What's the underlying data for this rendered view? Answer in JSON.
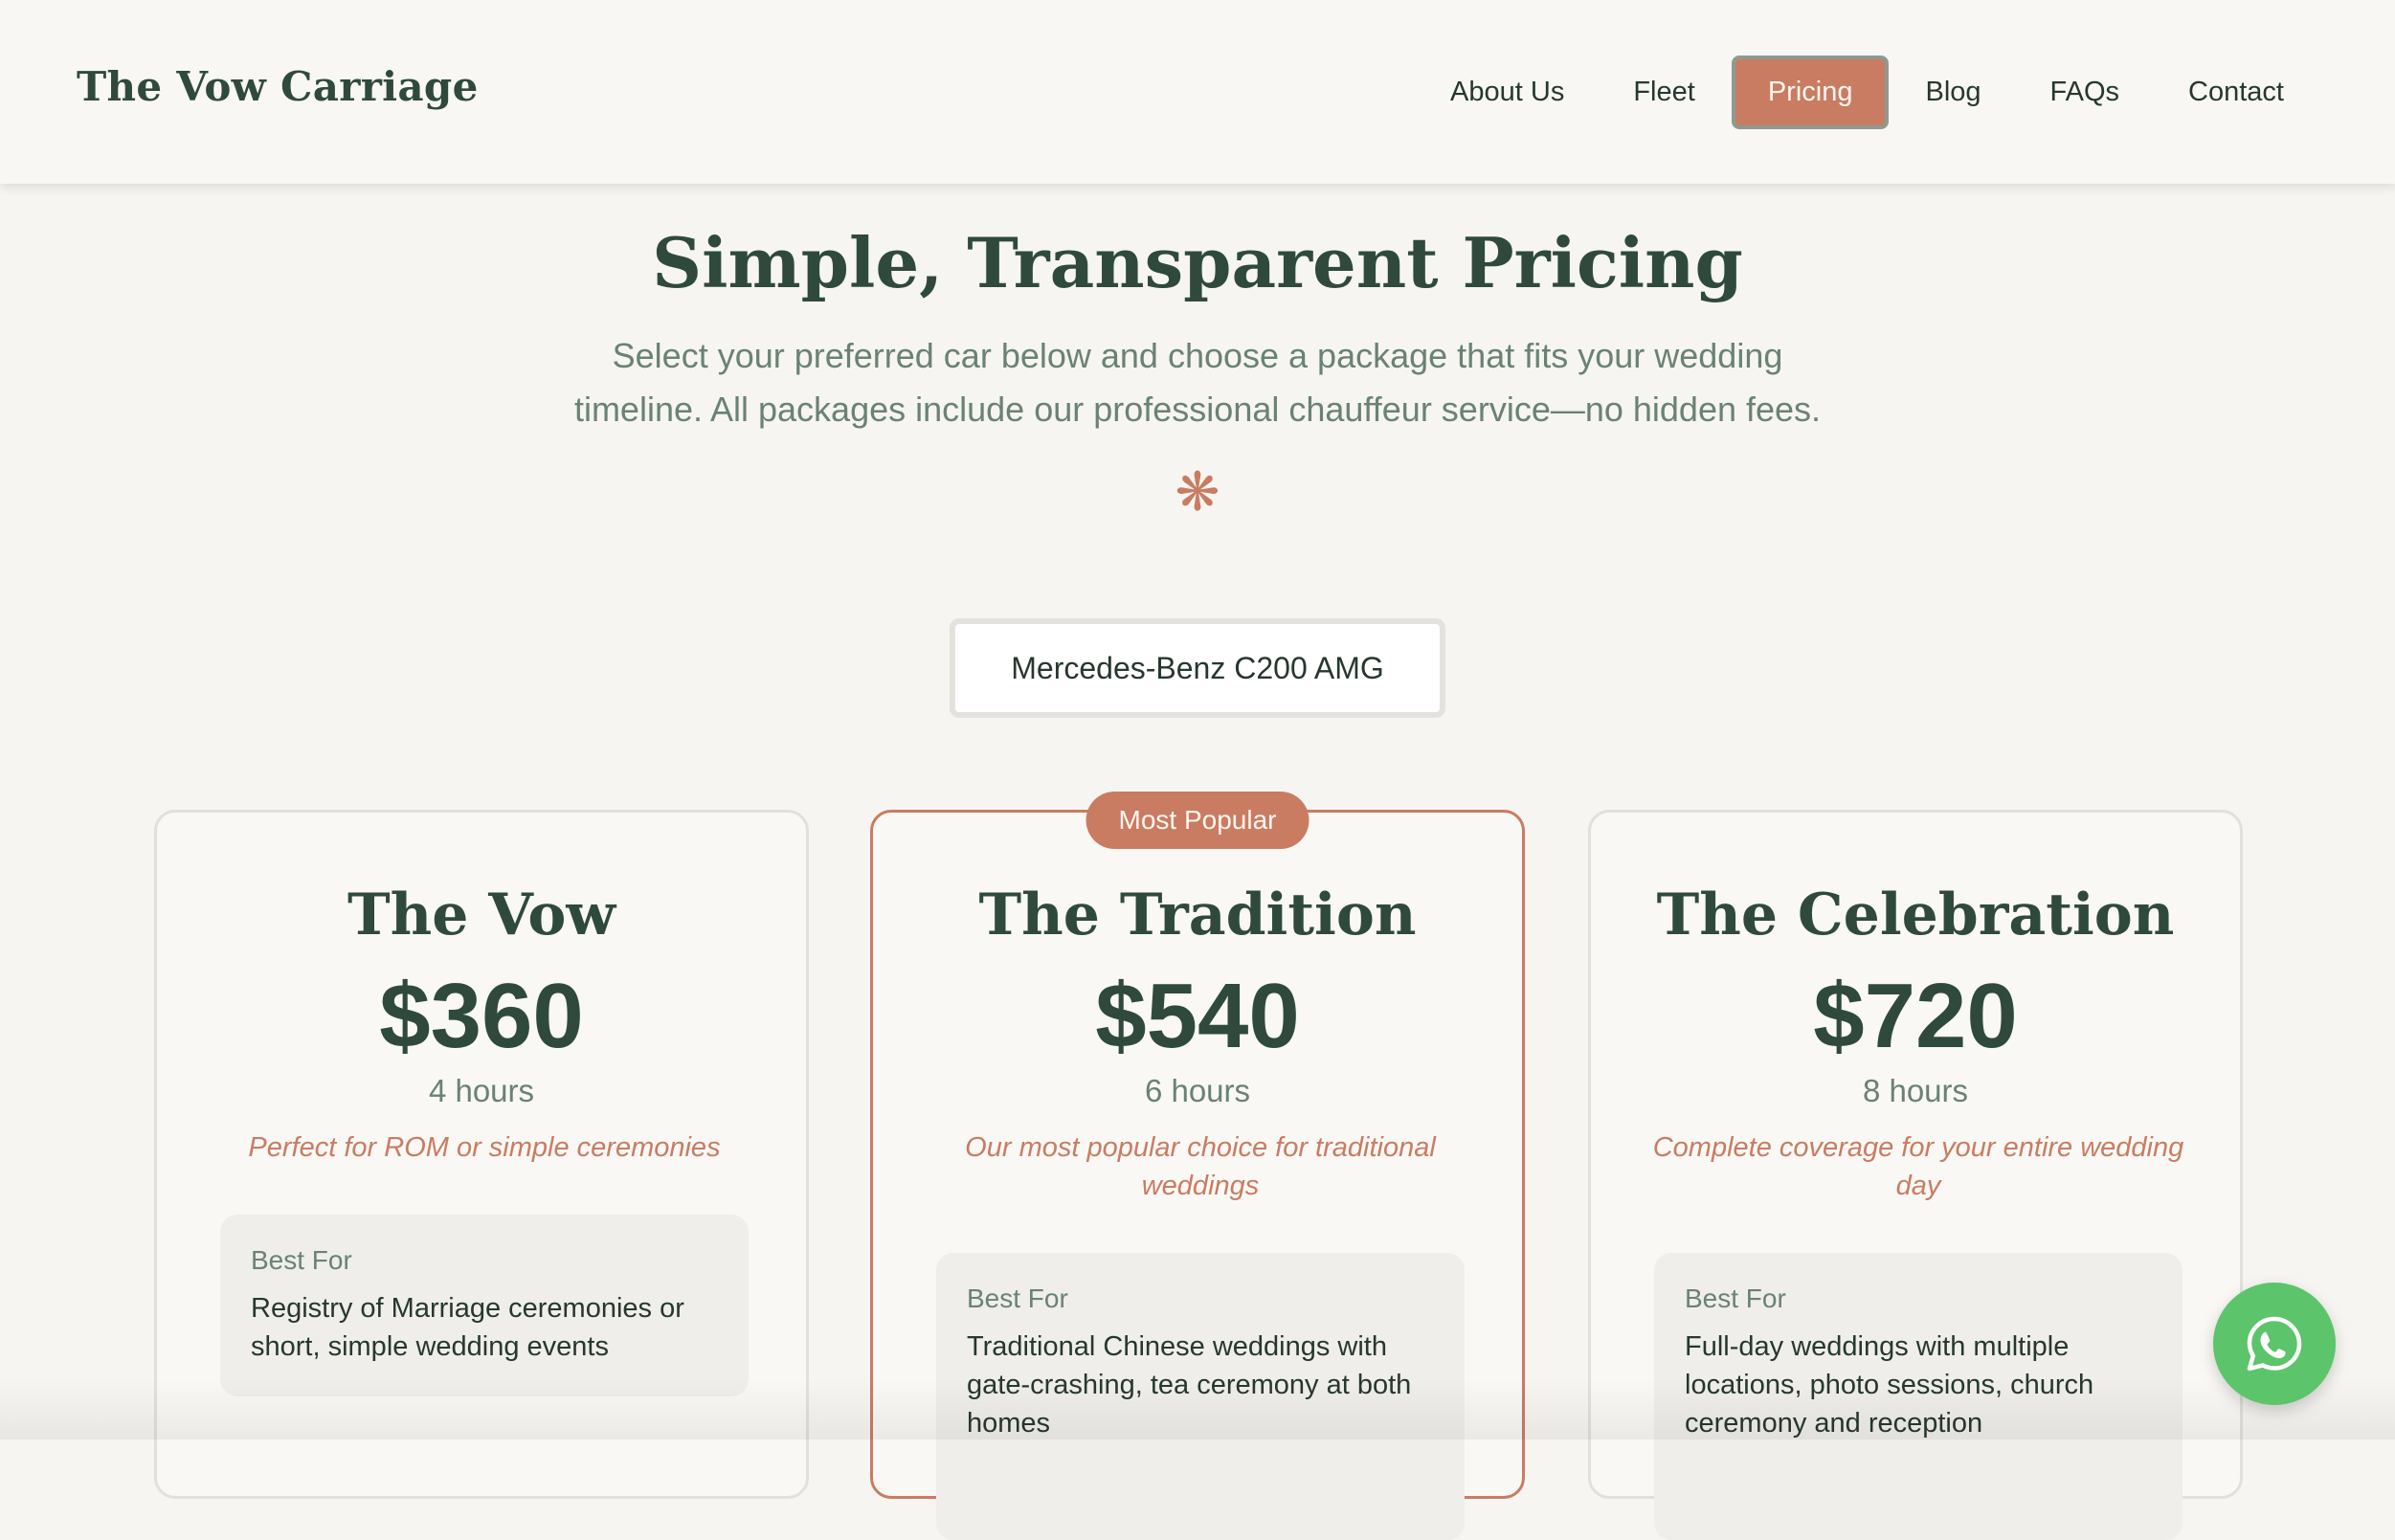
{
  "header": {
    "logo": "The Vow Carriage",
    "nav": [
      "About Us",
      "Fleet",
      "Pricing",
      "Blog",
      "FAQs",
      "Contact"
    ],
    "active": "Pricing"
  },
  "hero": {
    "title": "Simple, Transparent Pricing",
    "subtitle_line1": "Select your preferred car below and choose a package that fits your wedding",
    "subtitle_line2": "timeline. All packages include our professional chauffeur service—no hidden fees.",
    "ornament": "❋"
  },
  "car_select": {
    "value": "Mercedes-Benz C200 AMG"
  },
  "packages": [
    {
      "name": "The Vow",
      "price": "$360",
      "hours": "4 hours",
      "desc": "Perfect for ROM or simple ceremonies",
      "best_for_label": "Best For",
      "best_for": "Registry of Marriage ceremonies or short, simple wedding events"
    },
    {
      "name": "The Tradition",
      "price": "$540",
      "hours": "6 hours",
      "desc": "Our most popular choice for traditional weddings",
      "badge": "Most Popular",
      "best_for_label": "Best For",
      "best_for": "Traditional Chinese weddings with gate-crashing, tea ceremony at both homes"
    },
    {
      "name": "The Celebration",
      "price": "$720",
      "hours": "8 hours",
      "desc": "Complete coverage for your entire wedding day",
      "best_for_label": "Best For",
      "best_for": "Full-day weddings with multiple locations, photo sessions, church ceremony and reception"
    }
  ],
  "colors": {
    "accent": "#c97c62",
    "primary": "#2f4a3c",
    "muted": "#6a8273",
    "background": "#f6f5f1",
    "whatsapp": "#5cc46a"
  },
  "icons": {
    "floating_button": "whatsapp-icon"
  }
}
